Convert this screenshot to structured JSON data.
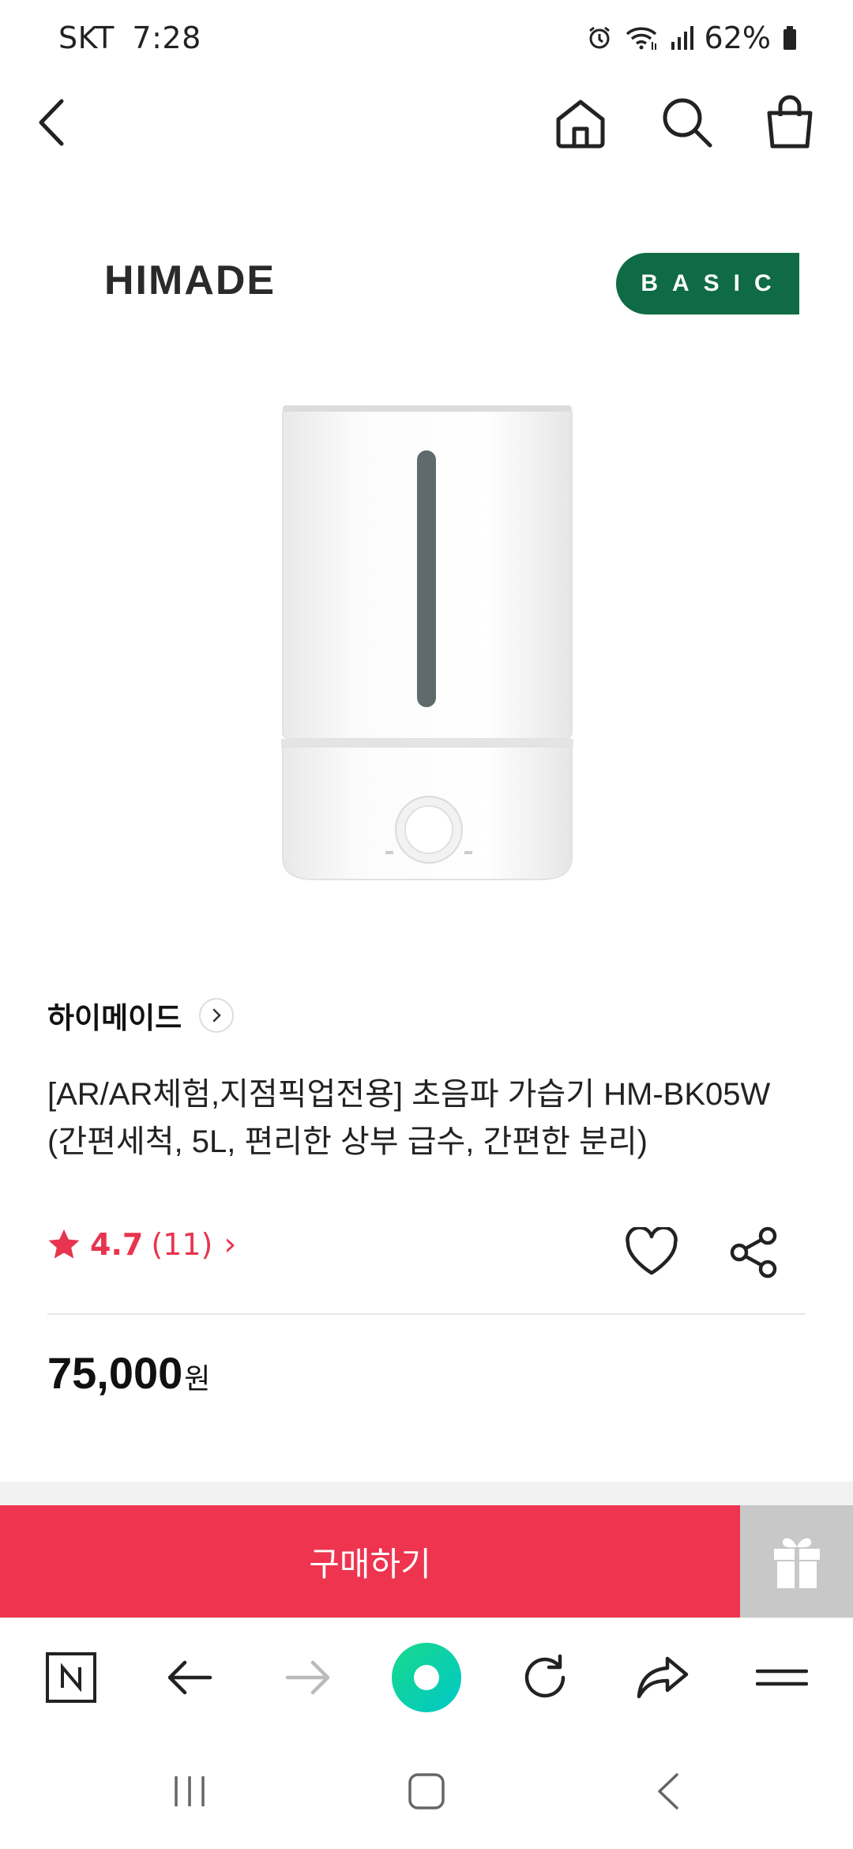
{
  "status_bar": {
    "carrier": "SKT",
    "time": "7:28",
    "battery": "62%",
    "icons": [
      "alarm-icon",
      "wifi-icon",
      "signal-icon",
      "battery-icon"
    ]
  },
  "top_nav": {
    "icons": [
      "back-arrow-icon",
      "home-icon",
      "search-icon",
      "shopping-bag-icon"
    ]
  },
  "banner": {
    "brand_logo": "HIMADE",
    "badge": "BASIC",
    "badge_color": "#0f6b45"
  },
  "product": {
    "image_icon": "humidifier-image",
    "brand": "하이메이드",
    "title": "[AR/AR체험,지점픽업전용] 초음파 가습기 HM-BK05W (간편세척, 5L, 편리한 상부 급수, 간편한 분리)",
    "rating": "4.7",
    "review_count": "(11)",
    "rating_arrow": "›",
    "price": "75,000",
    "price_unit": "원"
  },
  "actions": {
    "buy_label": "구매하기",
    "buy_color": "#ef344f",
    "gift_icon": "gift-icon"
  },
  "browser_toolbar": {
    "icons": [
      "naver-home-icon",
      "back-icon",
      "forward-icon",
      "green-dot-icon",
      "refresh-icon",
      "share-icon",
      "menu-icon"
    ]
  },
  "system_nav": {
    "icons": [
      "recent-apps-icon",
      "home-button-icon",
      "back-nav-icon"
    ]
  }
}
